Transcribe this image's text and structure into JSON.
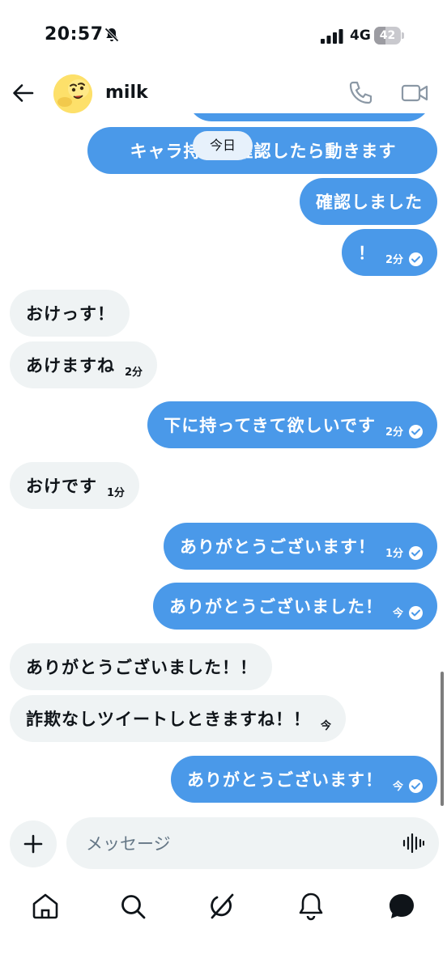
{
  "status_bar": {
    "time": "20:57",
    "network": "4G",
    "battery": "42",
    "battery_level": 0.42
  },
  "header": {
    "contact_name": "milk"
  },
  "day_divider": "今日",
  "messages": [
    {
      "side": "sent",
      "text": "キャラ持って確認したら動きます",
      "time": "",
      "read": false
    },
    {
      "side": "sent",
      "text": "確認しました",
      "time": "",
      "read": false
    },
    {
      "side": "sent",
      "text": "！",
      "time": "2分",
      "read": true
    },
    {
      "side": "recv",
      "text": "おけっす！",
      "time": ""
    },
    {
      "side": "recv",
      "text": "あけますね",
      "time": "2分"
    },
    {
      "side": "sent",
      "text": "下に持ってきて欲しいです",
      "time": "2分",
      "read": true
    },
    {
      "side": "recv",
      "text": "おけです",
      "time": "1分"
    },
    {
      "side": "sent",
      "text": "ありがとうございます！",
      "time": "1分",
      "read": true
    },
    {
      "side": "sent",
      "text": "ありがとうございました！",
      "time": "今",
      "read": true
    },
    {
      "side": "recv",
      "text": "ありがとうございました！！",
      "time": ""
    },
    {
      "side": "recv",
      "text": "詐欺なしツイートしときますね！！",
      "time": "今"
    },
    {
      "side": "sent",
      "text": "ありがとうございます！",
      "time": "今",
      "read": true
    }
  ],
  "composer": {
    "placeholder": "メッセージ"
  },
  "bottom_nav": [
    "home-icon",
    "search-icon",
    "grok-icon",
    "notifications-icon",
    "messages-icon"
  ],
  "colors": {
    "sent_bubble": "#4a99e9",
    "received_bubble": "#eff3f4",
    "text": "#0f1419",
    "placeholder": "#657786"
  }
}
